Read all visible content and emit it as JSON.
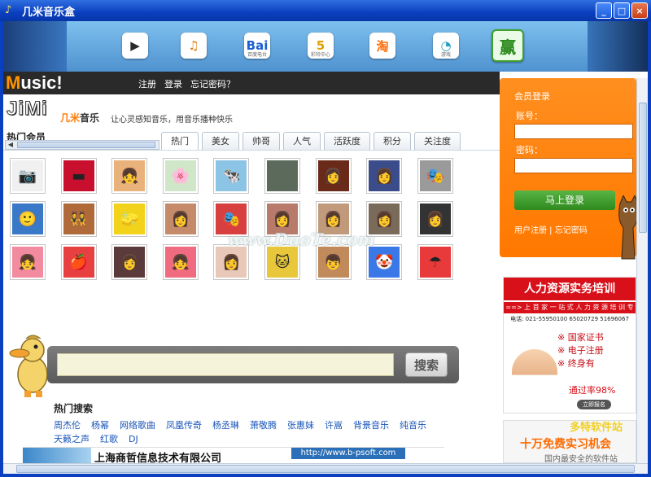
{
  "window": {
    "title": "几米音乐盒",
    "buttons": [
      "_",
      "□",
      "×"
    ]
  },
  "banner": {
    "apps": [
      {
        "icon": "play-icon",
        "glyph": "▶",
        "color": "#2a2a2a",
        "label": ""
      },
      {
        "icon": "music-note-icon",
        "glyph": "♫",
        "color": "#e07a10",
        "label": ""
      },
      {
        "icon": "baidu-icon",
        "glyph": "Bai",
        "color": "#1a5fd0",
        "label": "百度电台"
      },
      {
        "icon": "ring-icon",
        "glyph": "5",
        "color": "#e0a000",
        "label": "彩铃中心"
      },
      {
        "icon": "taobao-icon",
        "glyph": "淘",
        "color": "#ff6a00",
        "label": ""
      },
      {
        "icon": "game-icon",
        "glyph": "◔",
        "color": "#2aa0c0",
        "label": "游戏"
      },
      {
        "icon": "win-icon",
        "glyph": "赢",
        "color": "#2c8a1c",
        "label": ""
      }
    ]
  },
  "header": {
    "logo": "Music!",
    "links": [
      "注册",
      "登录",
      "忘记密码？"
    ]
  },
  "brand": {
    "logo": "JiMi",
    "name_a": "几米",
    "name_b": "音乐",
    "slogan": "让心灵感知音乐，用音乐播种快乐",
    "section_title": "热门会员"
  },
  "tabs": [
    "热门",
    "美女",
    "帅哥",
    "人气",
    "活跃度",
    "积分",
    "关注度"
  ],
  "avatars": [
    [
      "📷",
      "#f0f0f0"
    ],
    [
      "▬",
      "#c8102e"
    ],
    [
      "👧",
      "#e9b27a"
    ],
    [
      "🌸",
      "#cfe6c8"
    ],
    [
      "🐄",
      "#8cc4e6"
    ],
    [
      "",
      "#5c6a5c"
    ],
    [
      "👩",
      "#6a2a1a"
    ],
    [
      "👩",
      "#3a4c8a"
    ],
    [
      "🎭",
      "#9a9a9a"
    ],
    [
      "🙂",
      "#3a78c8"
    ],
    [
      "👯",
      "#b06a3a"
    ],
    [
      "🧽",
      "#f2d21a"
    ],
    [
      "👩",
      "#c48a6a"
    ],
    [
      "🎭",
      "#d84040"
    ],
    [
      "👩",
      "#b87a6a"
    ],
    [
      "👩",
      "#c09a7a"
    ],
    [
      "👩",
      "#7a6a5a"
    ],
    [
      "👩",
      "#333"
    ],
    [
      "👧",
      "#f28aa0"
    ],
    [
      "🍎",
      "#e84040"
    ],
    [
      "👩",
      "#5a3a3a"
    ],
    [
      "👧",
      "#f06a80"
    ],
    [
      "👩",
      "#e8c8b8"
    ],
    [
      "🐱",
      "#e8c83a"
    ],
    [
      "👦",
      "#c08a5a"
    ],
    [
      "🤡",
      "#3a78e8"
    ],
    [
      "☂",
      "#e83a3a"
    ]
  ],
  "search": {
    "value": "",
    "button": "搜索"
  },
  "hot": {
    "title": "热门搜索",
    "items": [
      "周杰伦",
      "杨幂",
      "网络歌曲",
      "凤凰传奇",
      "杨丞琳",
      "萧敬腾",
      "张惠妹",
      "许嵩",
      "背景音乐",
      "纯音乐",
      "天籁之声",
      "红歌",
      "DJ"
    ]
  },
  "bottom_ad": {
    "company": "上海商哲信息技术有限公司",
    "url": "http://www.b-psoft.com"
  },
  "login": {
    "title": "会员登录",
    "account_label": "账号：",
    "password_label": "密码：",
    "submit": "马上登录",
    "links": "用户注册 | 忘记密码"
  },
  "ad1": {
    "head": "人力资源实务培训",
    "strip": "==> 上 首 家 一 站 式 人 力 资 源 培 训 专 业 学 校 <==",
    "tel": "电话: 021-55950100  65020729  51696067",
    "list": [
      "※ 国家证书",
      "※ 电子注册",
      "※ 终身有"
    ],
    "rate": "通过率98%",
    "btn": "立即报名"
  },
  "ad2": {
    "title": "十万免费实习机会",
    "sub": "国内最安全的软件站"
  },
  "watermark": "www.DuoTe.com",
  "watermark2": "多特软件站"
}
